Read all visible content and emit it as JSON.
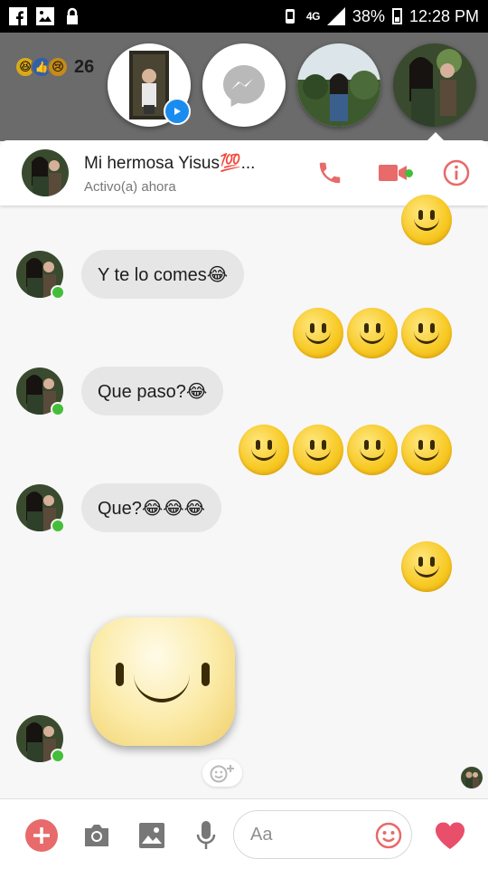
{
  "status_bar": {
    "network": "4G",
    "battery": "38%",
    "time": "12:28 PM"
  },
  "background_post": {
    "reaction_count": "26"
  },
  "conversation": {
    "contact_name": "Mi hermosa Yisus💯...",
    "status": "Activo(a) ahora"
  },
  "messages": [
    {
      "text": "Y te lo comes😂"
    },
    {
      "text": "Que paso?😂"
    },
    {
      "text": "Que?😂😂😂"
    }
  ],
  "composer": {
    "placeholder": "Aa"
  },
  "colors": {
    "accent": "#e86a6a",
    "online": "#44be3a",
    "messenger_blue": "#1a8cf0",
    "bubble_bg": "#e6e6e6"
  }
}
